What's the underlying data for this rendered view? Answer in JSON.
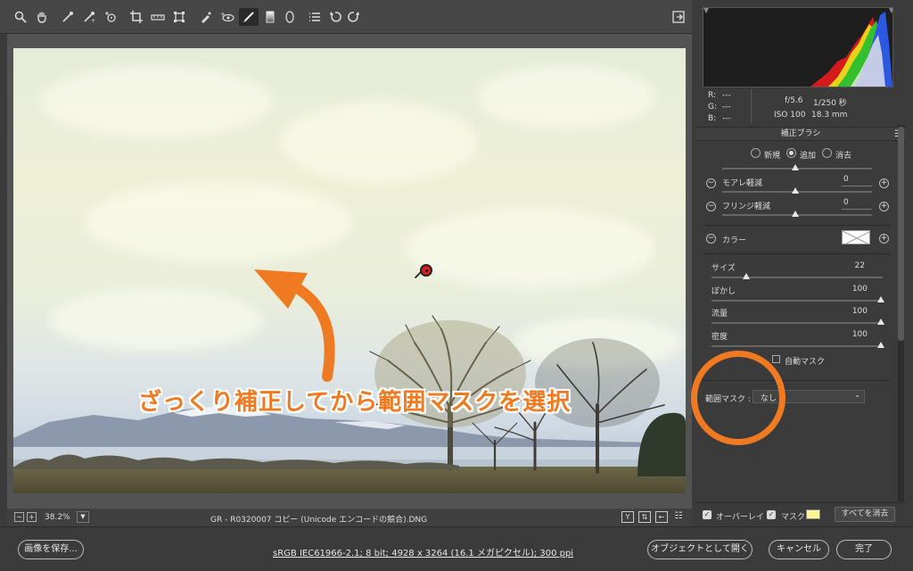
{
  "toolbar": {
    "tools": [
      {
        "name": "zoom-tool",
        "glyph": "🔍"
      },
      {
        "name": "hand-tool",
        "glyph": "✋"
      },
      {
        "name": "white-balance-tool",
        "glyph": "✎"
      },
      {
        "name": "color-sampler-tool",
        "glyph": "✎"
      },
      {
        "name": "targeted-adjustment-tool",
        "glyph": "◎"
      },
      {
        "name": "crop-tool",
        "glyph": "⌗"
      },
      {
        "name": "straighten-tool",
        "glyph": "▭"
      },
      {
        "name": "transform-tool",
        "glyph": "◇"
      },
      {
        "name": "spot-removal-tool",
        "glyph": "✐"
      },
      {
        "name": "red-eye-tool",
        "glyph": "⊙"
      },
      {
        "name": "adjustment-brush-tool",
        "glyph": "✏"
      },
      {
        "name": "graduated-filter-tool",
        "glyph": "▮"
      },
      {
        "name": "radial-filter-tool",
        "glyph": "◯"
      },
      {
        "name": "preferences-tool",
        "glyph": "☰"
      },
      {
        "name": "rotate-left-tool",
        "glyph": "↺"
      },
      {
        "name": "rotate-right-tool",
        "glyph": "↻"
      }
    ],
    "fullscreen_glyph": "⇲"
  },
  "annotation": {
    "text": "ざっくり補正してから範囲マスクを選択"
  },
  "canvas_status": {
    "zoom": "38.2%",
    "filename": "GR  -  R0320007 コピー (Unicode エンコードの競合).DNG"
  },
  "info": {
    "r_label": "R:",
    "g_label": "G:",
    "b_label": "B:",
    "r_value": "---",
    "g_value": "---",
    "b_value": "---",
    "aperture": "f/5.6",
    "shutter": "1/250 秒",
    "iso": "ISO 100",
    "focal": "18.3 mm"
  },
  "panel": {
    "title": "補正ブラシ",
    "modes": [
      "新規",
      "追加",
      "消去"
    ],
    "selected_mode": "追加",
    "moire_label": "モアレ軽減",
    "moire_value": "0",
    "fringe_label": "フリンジ軽減",
    "fringe_value": "0",
    "color_label": "カラー",
    "size_label": "サイズ",
    "size_value": "22",
    "feather_label": "ぼかし",
    "feather_value": "100",
    "flow_label": "流量",
    "flow_value": "100",
    "density_label": "密度",
    "density_value": "100",
    "automask_label": "自動マスク",
    "range_mask_label": "範囲マスク :",
    "range_mask_value": "なし",
    "overlay_label": "オーバーレイ",
    "mask_label": "マスク",
    "clear_all_label": "すべてを消去",
    "mask_color": "#fff599"
  },
  "bottom": {
    "save_label": "画像を保存...",
    "workflow_info": "sRGB IEC61966-2.1; 8 bit; 4928 x 3264 (16.1 メガピクセル); 300 ppi",
    "open_object_label": "オブジェクトとして開く",
    "cancel_label": "キャンセル",
    "done_label": "完了"
  },
  "colors": {
    "accent_orange": "#f07a22",
    "pin_red": "#d62020"
  }
}
